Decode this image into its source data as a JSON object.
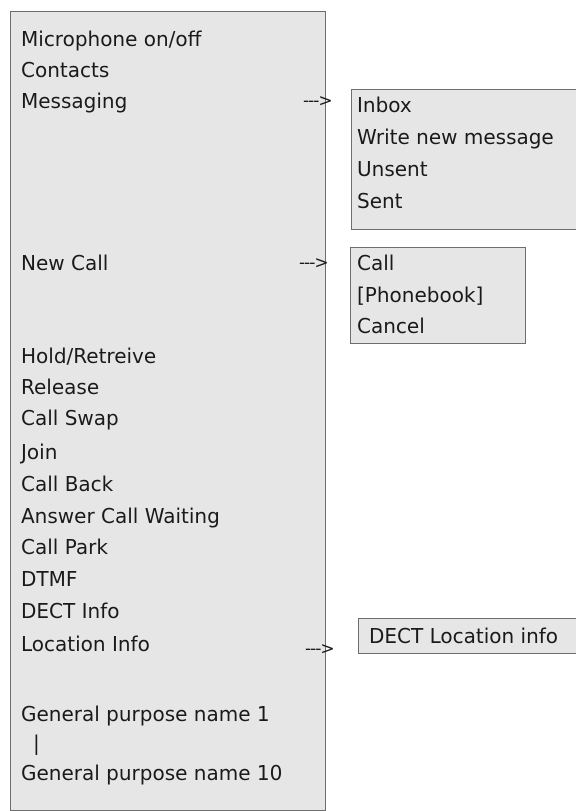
{
  "main_menu": {
    "items": [
      "Microphone on/off",
      "Contacts",
      "Messaging",
      "New Call",
      "Hold/Retreive",
      "Release",
      "Call Swap",
      "Join",
      "Call Back",
      "Answer Call Waiting",
      "Call Park",
      "DTMF",
      "DECT Info",
      "Location Info",
      "General purpose name 1",
      "|",
      "General purpose name 10"
    ]
  },
  "messaging_submenu": {
    "items": [
      "Inbox",
      "Write new message",
      "Unsent",
      "Sent"
    ]
  },
  "newcall_submenu": {
    "items": [
      "Call",
      "[Phonebook]",
      "Cancel"
    ]
  },
  "location_submenu": {
    "items": [
      "DECT Location info"
    ]
  },
  "connector": {
    "label": "--->"
  }
}
